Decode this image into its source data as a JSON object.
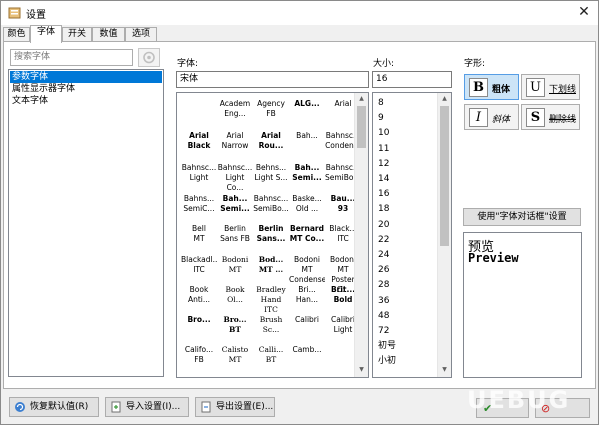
{
  "window": {
    "title": "设置"
  },
  "tabs": [
    "颜色",
    "字体",
    "开关",
    "数值",
    "选项"
  ],
  "active_tab": 1,
  "search": {
    "placeholder": "搜索字体"
  },
  "categories": [
    "参数字体",
    "属性显示器字体",
    "文本字体"
  ],
  "selected_category": 0,
  "font": {
    "label": "字体:",
    "value": "宋体",
    "list": [
      [
        "",
        "Academ\nEng...",
        "Agency FB",
        "ALG...",
        "Arial"
      ],
      [
        "Arial\nBlack",
        "Arial\nNarrow",
        "Arial\nRou...",
        "Bah...",
        "Bahnsc...\nConden..."
      ],
      [
        "Bahnsc...\nLight",
        "Bahnsc...\nLight Co...",
        "Behns...\nLight S...",
        "Bah...\nSemi...",
        "Bahnsc...\nSemiBol..."
      ],
      [
        "Bahns...\nSemiC...",
        "Bah...\nSemi...",
        "Bahnsc...\nSemiBo...",
        "Baske...\nOld ...",
        "Bau...\n93"
      ],
      [
        "Bell\nMT",
        "Berlin\nSans FB",
        "Berlin\nSans...",
        "Bernard\nMT Co...",
        "Black...\nITC"
      ],
      [
        "Blackadl...\nITC",
        "Bodoni\nMT",
        "Bod...\nMT ...",
        "Bodoni MT\nCondensed",
        "Bodoni MT\nPoster C..."
      ],
      [
        "Book\nAnti...",
        "Book\nOl...",
        "Bradley\nHand\nITC",
        "Bri...\nHan...",
        "Brit...\nBold"
      ],
      [
        "Bro...",
        "Bro...\nBT",
        "Brush\nSc...",
        "Calibri",
        "Calibri\nLight"
      ],
      [
        "Califo...\nFB",
        "Calisto\nMT",
        "Calli...\nBT",
        "Camb...",
        ""
      ]
    ]
  },
  "size": {
    "label": "大小:",
    "value": "16",
    "list": [
      "8",
      "9",
      "10",
      "11",
      "12",
      "14",
      "16",
      "18",
      "20",
      "22",
      "24",
      "26",
      "28",
      "36",
      "48",
      "72",
      "初号",
      "小初"
    ]
  },
  "style": {
    "label": "字形:",
    "bold": {
      "icon": "B",
      "label": "粗体",
      "active": true
    },
    "underline": {
      "icon": "U",
      "label": "下划线",
      "active": false
    },
    "italic": {
      "icon": "I",
      "label": "斜体",
      "active": false
    },
    "strike": {
      "icon": "S",
      "label": "删除线",
      "active": false
    }
  },
  "use_dialog_button": "使用\"字体对话框\"设置",
  "preview": {
    "line1": "预览",
    "line2": "Preview"
  },
  "buttons": {
    "restore": "恢复默认值(R)",
    "import": "导入设置(I)...",
    "export": "导出设置(E)..."
  },
  "watermark": "UEBUG",
  "colors": {
    "selection": "#0078d7",
    "toggle_on": "#cce4f7"
  }
}
